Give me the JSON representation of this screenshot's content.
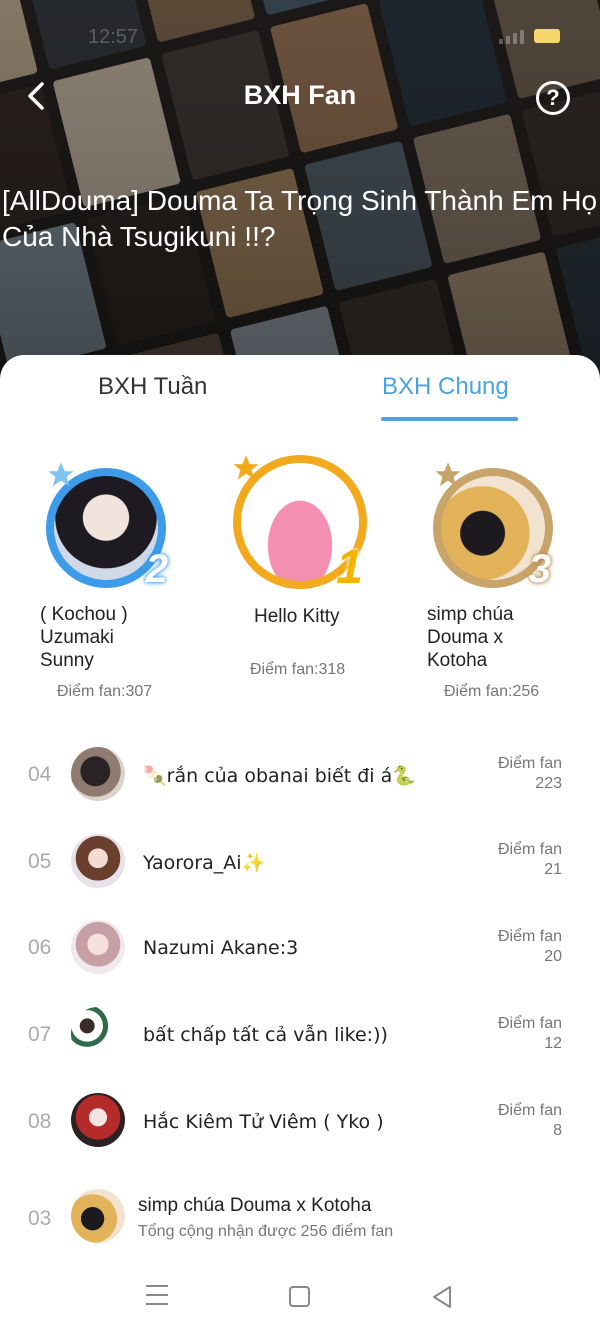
{
  "status_bar": {
    "time": "12:57"
  },
  "header": {
    "title": "BXH Fan"
  },
  "story": {
    "title": "[AllDouma] Douma Ta Trọng Sinh Thành Em Họ Của Nhà Tsugikuni !!?"
  },
  "tabs": [
    {
      "label": "BXH Tuần",
      "active": false
    },
    {
      "label": "BXH Chung",
      "active": true
    }
  ],
  "podium": {
    "second": {
      "rank": "2",
      "name": "( Kochou ) Uzumaki Sunny",
      "points": "Điểm fan:307"
    },
    "first": {
      "rank": "1",
      "name": "Hello Kitty",
      "points": "Điểm fan:318"
    },
    "third": {
      "rank": "3",
      "name": "simp chúa Douma x Kotoha",
      "points": "Điểm fan:256"
    }
  },
  "list": [
    {
      "rank": "04",
      "name": "🍡rắn của obanai biết đi á🐍",
      "points_label": "Điểm fan",
      "points": "223"
    },
    {
      "rank": "05",
      "name": "Yaorora_Ai✨",
      "points_label": "Điểm fan",
      "points": "21"
    },
    {
      "rank": "06",
      "name": "Nazumi Akane:3",
      "points_label": "Điểm fan",
      "points": "20"
    },
    {
      "rank": "07",
      "name": "bất chấp tất cả vẫn like:))",
      "points_label": "Điểm fan",
      "points": "12"
    },
    {
      "rank": "08",
      "name": "Hắc Kiêm Tử Viêm ( Yko )",
      "points_label": "Điểm fan",
      "points": "8"
    }
  ],
  "my_rank": {
    "rank": "03",
    "name": "simp chúa Douma x Kotoha",
    "subtitle": "Tổng cộng nhận được 256 điểm fan"
  },
  "colors": {
    "accent": "#4aa3df",
    "gold": "#f2a91c",
    "silver_blue": "#3d9be9",
    "bronze": "#c9a46a"
  },
  "icons": [
    "back-icon",
    "help-icon",
    "star-icon",
    "menu-icon",
    "home-icon",
    "nav-back-icon"
  ]
}
